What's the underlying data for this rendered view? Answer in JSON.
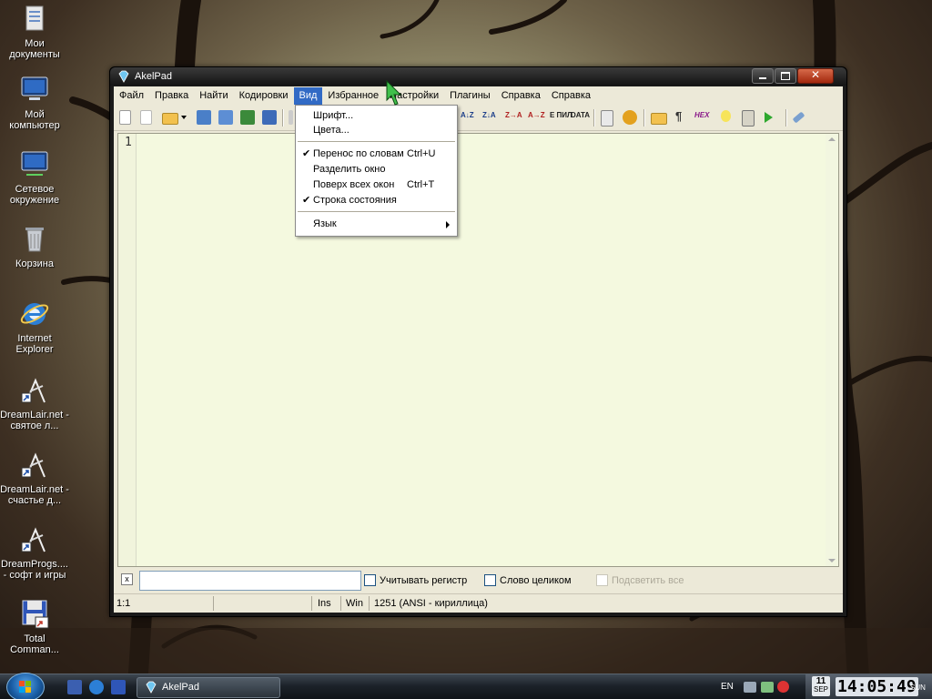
{
  "desktop": {
    "icons": [
      {
        "label": "Мои документы",
        "icon": "my-documents-icon"
      },
      {
        "label": "Мой компьютер",
        "icon": "my-computer-icon"
      },
      {
        "label": "Сетевое окружение",
        "icon": "network-icon"
      },
      {
        "label": "Корзина",
        "icon": "recycle-bin-icon"
      },
      {
        "label": "Internet Explorer",
        "icon": "ie-icon"
      },
      {
        "label": "DreamLair.net - святое л...",
        "icon": "shortcut-icon"
      },
      {
        "label": "DreamLair.net - счастье д...",
        "icon": "shortcut-icon"
      },
      {
        "label": "DreamProgs.... - софт и игры",
        "icon": "shortcut-icon"
      },
      {
        "label": "Total Comman...",
        "icon": "total-commander-icon"
      }
    ]
  },
  "window": {
    "title": "AkelPad",
    "menu": [
      "Файл",
      "Правка",
      "Найти",
      "Кодировки",
      "Вид",
      "Избранное",
      "Настройки",
      "Плагины",
      "Справка",
      "Справка"
    ],
    "active_menu": "Вид",
    "toolbar": {
      "az_down": "A↓Z",
      "za_down": "Z↓A",
      "z_to_a": "Z→A",
      "a_to_z": "A→Z",
      "e_pil": "E ПИЛ",
      "data": "DATA",
      "hex": "HEX"
    },
    "editor": {
      "line_number": "1",
      "content": ""
    },
    "findbar": {
      "close": "x",
      "search_value": "",
      "match_case": "Учитывать регистр",
      "whole_word": "Слово целиком",
      "highlight_all": "Подсветить все"
    },
    "status": {
      "position": "1:1",
      "mode": "Ins",
      "newline": "Win",
      "codepage": "1251  (ANSI - кириллица)"
    }
  },
  "dropdown": {
    "items": [
      {
        "label": "Шрифт...",
        "shortcut": "",
        "checked": false
      },
      {
        "label": "Цвета...",
        "shortcut": "",
        "checked": false
      },
      {
        "label": "Перенос по словам",
        "shortcut": "Ctrl+U",
        "checked": true
      },
      {
        "label": "Разделить окно",
        "shortcut": "",
        "checked": false
      },
      {
        "label": "Поверх всех окон",
        "shortcut": "Ctrl+T",
        "checked": false
      },
      {
        "label": "Строка состояния",
        "shortcut": "",
        "checked": true
      },
      {
        "label": "Язык",
        "shortcut": "",
        "checked": false,
        "submenu": true
      }
    ],
    "check_glyph": "✔"
  },
  "taskbar": {
    "task": "AkelPad",
    "lang": "EN",
    "clock": {
      "day": "11",
      "month": "SEP",
      "time": "14:05:49",
      "weekday": "SUN"
    }
  }
}
